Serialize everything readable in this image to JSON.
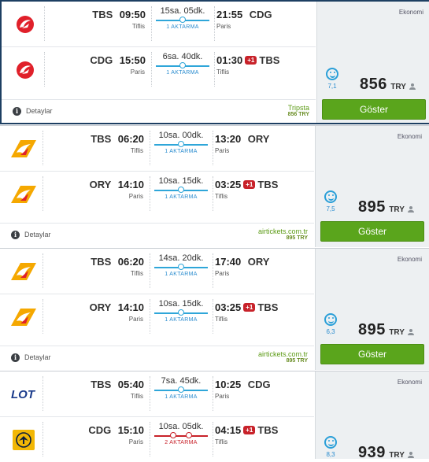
{
  "results": [
    {
      "cabin": "Ekonomi",
      "legs": [
        {
          "airline_logo": "turkish-airlines-logo",
          "dep_code": "TBS",
          "dep_time": "09:50",
          "dep_city": "Tiflis",
          "duration": "15sa. 05dk.",
          "stops": "1 AKTARMA",
          "arr_time": "21:55",
          "arr_code": "CDG",
          "arr_city": "Paris",
          "day_plus": ""
        },
        {
          "airline_logo": "turkish-airlines-logo",
          "dep_code": "CDG",
          "dep_time": "15:50",
          "dep_city": "Paris",
          "duration": "6sa. 40dk.",
          "stops": "1 AKTARMA",
          "arr_time": "01:30",
          "arr_code": "TBS",
          "arr_city": "Tiflis",
          "day_plus": "+1"
        }
      ],
      "details_label": "Detaylar",
      "provider": "Tripsta",
      "provider_price": "856 TRY",
      "score": "7,1",
      "price": "856",
      "currency": "TRY",
      "button_label": "Göster"
    },
    {
      "cabin": "Ekonomi",
      "legs": [
        {
          "airline_logo": "pegasus-logo",
          "dep_code": "TBS",
          "dep_time": "06:20",
          "dep_city": "Tiflis",
          "duration": "10sa. 00dk.",
          "stops": "1 AKTARMA",
          "arr_time": "13:20",
          "arr_code": "ORY",
          "arr_city": "Paris",
          "day_plus": ""
        },
        {
          "airline_logo": "pegasus-logo",
          "dep_code": "ORY",
          "dep_time": "14:10",
          "dep_city": "Paris",
          "duration": "10sa. 15dk.",
          "stops": "1 AKTARMA",
          "arr_time": "03:25",
          "arr_code": "TBS",
          "arr_city": "Tiflis",
          "day_plus": "+1"
        }
      ],
      "details_label": "Detaylar",
      "provider": "airtickets.com.tr",
      "provider_price": "895 TRY",
      "score": "7,5",
      "price": "895",
      "currency": "TRY",
      "button_label": "Göster"
    },
    {
      "cabin": "Ekonomi",
      "legs": [
        {
          "airline_logo": "pegasus-logo",
          "dep_code": "TBS",
          "dep_time": "06:20",
          "dep_city": "Tiflis",
          "duration": "14sa. 20dk.",
          "stops": "1 AKTARMA",
          "arr_time": "17:40",
          "arr_code": "ORY",
          "arr_city": "Paris",
          "day_plus": ""
        },
        {
          "airline_logo": "pegasus-logo",
          "dep_code": "ORY",
          "dep_time": "14:10",
          "dep_city": "Paris",
          "duration": "10sa. 15dk.",
          "stops": "1 AKTARMA",
          "arr_time": "03:25",
          "arr_code": "TBS",
          "arr_city": "Tiflis",
          "day_plus": "+1"
        }
      ],
      "details_label": "Detaylar",
      "provider": "airtickets.com.tr",
      "provider_price": "895 TRY",
      "score": "6,3",
      "price": "895",
      "currency": "TRY",
      "button_label": "Göster"
    },
    {
      "cabin": "Ekonomi",
      "legs": [
        {
          "airline_logo": "lot-logo",
          "dep_code": "TBS",
          "dep_time": "05:40",
          "dep_city": "Tiflis",
          "duration": "7sa. 45dk.",
          "stops": "1 AKTARMA",
          "arr_time": "10:25",
          "arr_code": "CDG",
          "arr_city": "Paris",
          "day_plus": ""
        },
        {
          "airline_logo": "lufthansa-logo",
          "dep_code": "CDG",
          "dep_time": "15:10",
          "dep_city": "Paris",
          "duration": "10sa. 05dk.",
          "stops": "2 AKTARMA",
          "arr_time": "04:15",
          "arr_code": "TBS",
          "arr_city": "Tiflis",
          "day_plus": "+1"
        }
      ],
      "score": "8,3",
      "price": "939",
      "currency": "TRY"
    }
  ],
  "colors": {
    "accent_blue": "#2fa6d9",
    "stop_red": "#c8222a",
    "button_green": "#5aa51c",
    "selected_border": "#1d3f62"
  }
}
